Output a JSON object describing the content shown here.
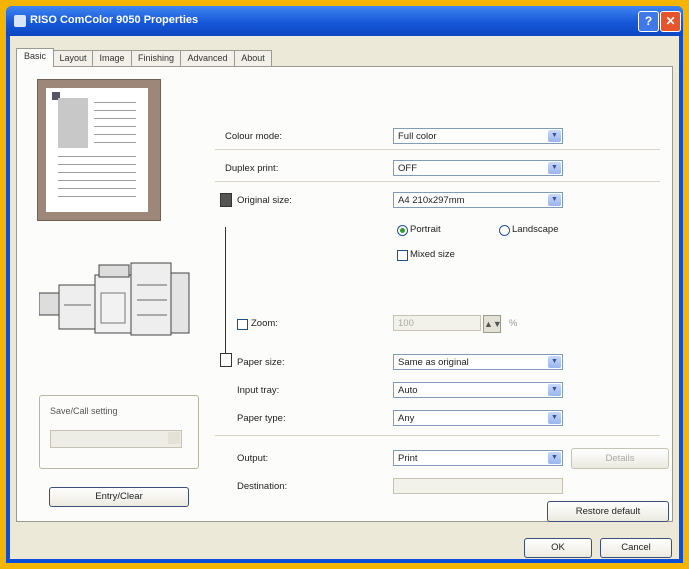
{
  "window": {
    "title": "RISO ComColor 9050 Properties",
    "help_glyph": "?",
    "close_glyph": "✕"
  },
  "tabs": [
    {
      "label": "Basic",
      "active": true
    },
    {
      "label": "Layout"
    },
    {
      "label": "Image"
    },
    {
      "label": "Finishing"
    },
    {
      "label": "Advanced"
    },
    {
      "label": "About"
    }
  ],
  "left": {
    "save_call_title": "Save/Call setting",
    "save_call_value": "",
    "entry_clear_button": "Entry/Clear"
  },
  "form": {
    "colour_mode": {
      "label": "Colour mode:",
      "value": "Full color"
    },
    "duplex_print": {
      "label": "Duplex print:",
      "value": "OFF"
    },
    "original_size": {
      "label": "Original size:",
      "value": "A4 210x297mm"
    },
    "orientation": {
      "portrait": "Portrait",
      "landscape": "Landscape",
      "selected": "Portrait"
    },
    "mixed_size": {
      "label": "Mixed size",
      "checked": false
    },
    "zoom": {
      "label": "Zoom:",
      "checked": false,
      "value": "100",
      "unit": "%"
    },
    "paper_size": {
      "label": "Paper size:",
      "value": "Same as original"
    },
    "input_tray": {
      "label": "Input tray:",
      "value": "Auto"
    },
    "paper_type": {
      "label": "Paper type:",
      "value": "Any"
    },
    "output": {
      "label": "Output:",
      "value": "Print"
    },
    "details_button": "Details",
    "destination": {
      "label": "Destination:",
      "value": ""
    },
    "restore_default_button": "Restore default"
  },
  "footer": {
    "ok": "OK",
    "cancel": "Cancel"
  },
  "icons": {
    "dropdown": "chevron-down-icon",
    "spin": "spin-buttons-icon",
    "original_doc": "document-icon",
    "paper_doc": "paper-icon"
  },
  "colors": {
    "title_bar": "#0b4fd6",
    "background": "#f4b400",
    "preview_frame": "#9d8778"
  }
}
